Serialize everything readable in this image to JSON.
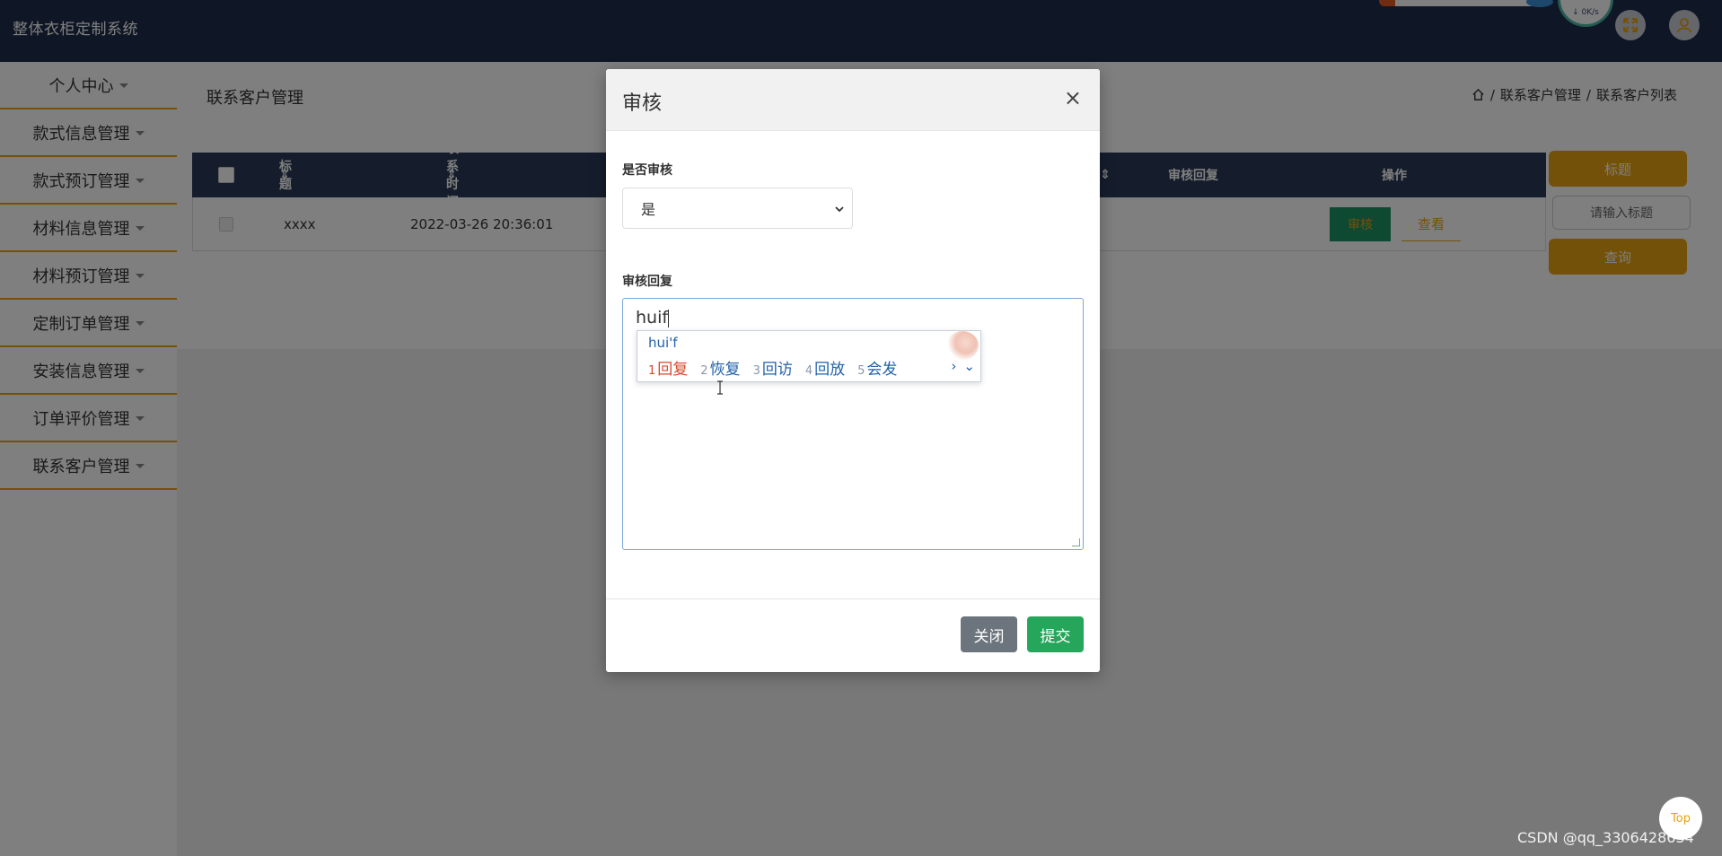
{
  "header": {
    "brand": "整体衣柜定制系统",
    "net_speed": "↓ 0K/s"
  },
  "sidebar": {
    "items": [
      {
        "label": "个人中心"
      },
      {
        "label": "款式信息管理"
      },
      {
        "label": "款式预订管理"
      },
      {
        "label": "材料信息管理"
      },
      {
        "label": "材料预订管理"
      },
      {
        "label": "定制订单管理"
      },
      {
        "label": "安装信息管理"
      },
      {
        "label": "订单评价管理"
      },
      {
        "label": "联系客户管理"
      }
    ]
  },
  "main": {
    "page_title": "联系客户管理",
    "breadcrumb": [
      "联系客户管理",
      "/",
      "联系客户列表"
    ],
    "breadcrumb_sep": "/",
    "table": {
      "headers": {
        "title": "标题",
        "contact_time": "联系时间",
        "review_reply": "审核回复",
        "actions": "操作"
      },
      "row": {
        "title": "xxxx",
        "contact_time": "2022-03-26 20:36:01",
        "audit_label": "审核",
        "view_label": "查看"
      }
    },
    "right_panel": {
      "title_button": "标题",
      "search_placeholder": "请输入标题",
      "query_button": "查询"
    }
  },
  "modal": {
    "title": "审核",
    "close_symbol": "×",
    "review_label": "是否审核",
    "review_value": "是",
    "reply_label": "审核回复",
    "reply_text": "huif",
    "ime": {
      "pinyin": "hui'f",
      "candidates": [
        {
          "num": "1",
          "text": "回复"
        },
        {
          "num": "2",
          "text": "恢复"
        },
        {
          "num": "3",
          "text": "回访"
        },
        {
          "num": "4",
          "text": "回放"
        },
        {
          "num": "5",
          "text": "会发"
        }
      ],
      "nav_next": "›",
      "nav_expand": "⌄"
    },
    "close_button": "关闭",
    "submit_button": "提交"
  },
  "floating": {
    "top_button": "Top",
    "watermark": "CSDN @qq_3306428634"
  },
  "colors": {
    "header_bg": "#1f2d4a",
    "accent": "#e8a211",
    "submit": "#26a65b",
    "close": "#6c757d"
  }
}
